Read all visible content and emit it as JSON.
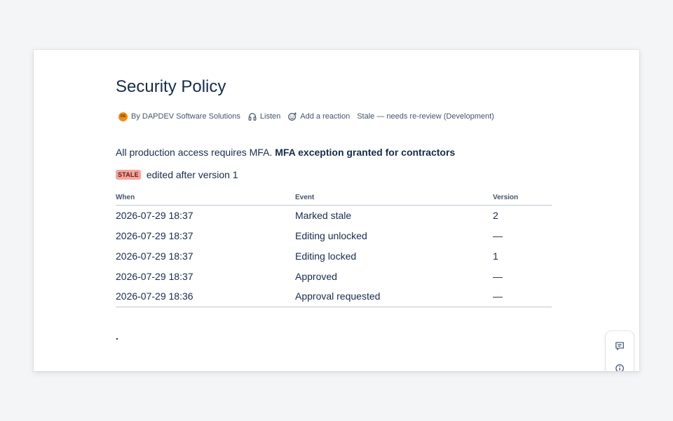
{
  "page": {
    "title": "Security Policy",
    "byline": {
      "avatar_initials": "DS",
      "author": "By DAPDEV Software Solutions",
      "listen": "Listen",
      "reaction": "Add a reaction",
      "status": "Stale — needs re-review (Development)"
    },
    "body": {
      "text": "All production access requires MFA.",
      "bold_text": "MFA exception granted for contractors"
    },
    "stale": {
      "badge": "STALE",
      "text": "edited after version 1"
    },
    "audit_table": {
      "headers": {
        "when": "When",
        "event": "Event",
        "version": "Version"
      },
      "rows": [
        {
          "when": "2026-07-29 18:37",
          "event": "Marked stale",
          "version": "2"
        },
        {
          "when": "2026-07-29 18:37",
          "event": "Editing unlocked",
          "version": "—"
        },
        {
          "when": "2026-07-29 18:37",
          "event": "Editing locked",
          "version": "1"
        },
        {
          "when": "2026-07-29 18:37",
          "event": "Approved",
          "version": "—"
        },
        {
          "when": "2026-07-29 18:36",
          "event": "Approval requested",
          "version": "—"
        }
      ]
    },
    "trailing_text": "."
  },
  "side_panel": {
    "buttons": [
      "comment-icon",
      "info-icon"
    ]
  },
  "colors": {
    "background": "#f4f5f7",
    "avatar": "#f18d13",
    "stale_badge": "#f8a39c",
    "text": "#172b4d"
  }
}
